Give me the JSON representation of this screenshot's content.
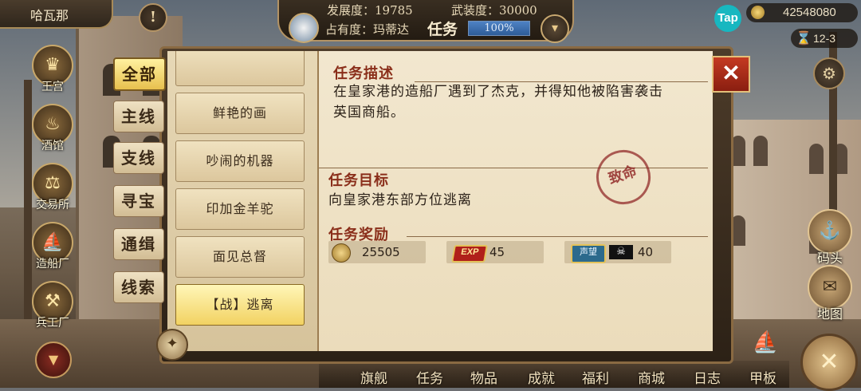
{
  "location": "哈瓦那",
  "top_stats": {
    "development_label": "发展度：19785",
    "armament_label": "武装度：30000",
    "occupancy_label": "占有度：玛蒂达",
    "quest_label": "任务",
    "progress_text": "100%",
    "progress_value": 1.0
  },
  "currency": {
    "tap_label": "Tap",
    "gold": "42548080",
    "date": "12-3"
  },
  "left_menu": [
    "王宫",
    "酒馆",
    "交易所",
    "造船厂",
    "兵工厂"
  ],
  "right_menu": [
    "码头",
    "地图"
  ],
  "bottom_menu": [
    "旗舰",
    "任务",
    "物品",
    "成就",
    "福利",
    "商城",
    "日志",
    "甲板"
  ],
  "categories": [
    {
      "label": "全部",
      "active": true
    },
    {
      "label": "主线",
      "active": false
    },
    {
      "label": "支线",
      "active": false
    },
    {
      "label": "寻宝",
      "active": false
    },
    {
      "label": "通缉",
      "active": false
    },
    {
      "label": "线索",
      "active": false
    }
  ],
  "quests": [
    {
      "label": "鲜艳的画",
      "active": false
    },
    {
      "label": "吵闹的机器",
      "active": false
    },
    {
      "label": "印加金羊驼",
      "active": false
    },
    {
      "label": "面见总督",
      "active": false
    },
    {
      "label": "【战】逃离",
      "active": true
    }
  ],
  "detail": {
    "desc_title": "任务描述",
    "desc_text_line1": "在皇家港的造船厂遇到了杰克，并得知他被陷害袭击",
    "desc_text_line2": "英国商船。",
    "target_title": "任务目标",
    "target_text": "向皇家港东部方位逃离",
    "reward_title": "任务奖励",
    "stamp": "致命",
    "rewards": {
      "gold": "25505",
      "exp_label": "EXP",
      "exp": "45",
      "reputation_label": "声望",
      "reputation": "40"
    }
  },
  "colors": {
    "accent_red": "#8a2e1a",
    "active_tab": "#e7c04e",
    "progress_blue": "#2e5c98"
  },
  "icons": [
    "alert-icon",
    "gear-icon",
    "close-icon",
    "compass-icon",
    "coin-icon",
    "hourglass-icon",
    "skull-flag-icon",
    "ship-icon"
  ]
}
